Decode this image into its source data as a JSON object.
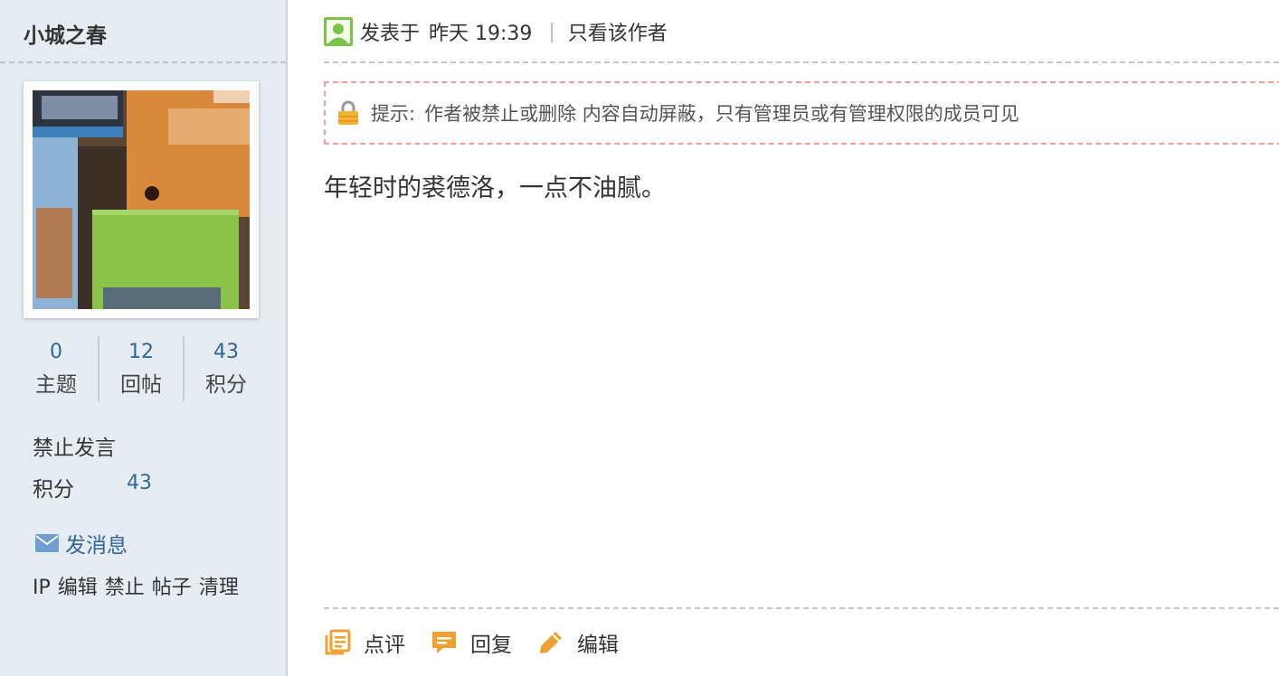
{
  "author": {
    "username": "小城之春",
    "stats": [
      {
        "value": "0",
        "label": "主题"
      },
      {
        "value": "12",
        "label": "回帖"
      },
      {
        "value": "43",
        "label": "积分"
      }
    ],
    "status": "禁止发言",
    "points_label": "积分",
    "points_value": "43",
    "message_link": "发消息",
    "admin_links": [
      "IP",
      "编辑",
      "禁止",
      "帖子",
      "清理"
    ]
  },
  "post": {
    "posted_label": "发表于",
    "posted_time": "昨天 19:39",
    "only_author_link": "只看该作者",
    "notice_prefix": "提示:",
    "notice_text": "作者被禁止或删除 内容自动屏蔽，只有管理员或有管理权限的成员可见",
    "body": "年轻时的裘德洛，一点不油腻。"
  },
  "actions": {
    "comment": "点评",
    "reply": "回复",
    "edit": "编辑"
  },
  "colors": {
    "sidebar_bg": "#e5edf2",
    "link_blue": "#336699",
    "notice_border": "#f09b9b",
    "action_icon_orange": "#f0a030"
  },
  "icons": [
    "user-online-icon",
    "lock-icon",
    "mail-icon",
    "comment-icon",
    "reply-icon",
    "edit-icon"
  ]
}
